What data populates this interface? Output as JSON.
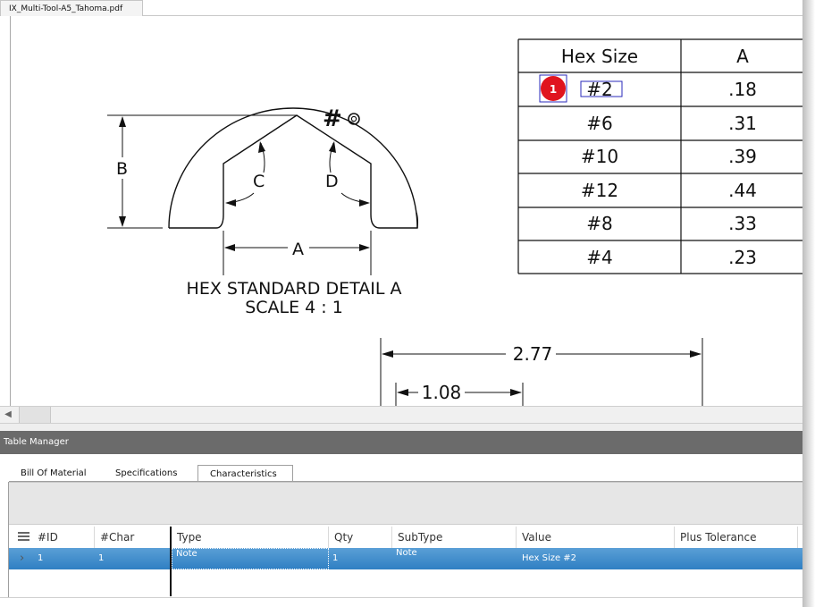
{
  "document": {
    "tab_title": "IX_Multi-Tool-A5_Tahoma.pdf"
  },
  "drawing": {
    "detail_title": "HEX STANDARD DETAIL A",
    "detail_scale": "SCALE 4 : 1",
    "hex_symbol": "#",
    "dim_a": "A",
    "dim_b": "B",
    "dim_c": "C",
    "dim_d": "D",
    "dim_277": "2.77",
    "dim_108": "1.08",
    "balloon_number": "1"
  },
  "hex_table": {
    "headers": [
      "Hex Size",
      "A"
    ],
    "rows": [
      [
        "#2",
        ".18"
      ],
      [
        "#6",
        ".31"
      ],
      [
        "#10",
        ".39"
      ],
      [
        "#12",
        ".44"
      ],
      [
        "#8",
        ".33"
      ],
      [
        "#4",
        ".23"
      ]
    ]
  },
  "table_manager": {
    "title": "Table Manager",
    "tabs": [
      "Bill Of Material",
      "Specifications",
      "Characteristics"
    ],
    "active_tab": "Characteristics",
    "columns": [
      "#ID",
      "#Char",
      "Type",
      "Qty",
      "SubType",
      "Value",
      "Plus Tolerance"
    ],
    "rows": [
      {
        "id": "1",
        "char": "1",
        "type": "Note",
        "qty": "1",
        "subtype": "Note",
        "value": "Hex Size #2",
        "plus_tolerance": ""
      }
    ]
  },
  "colors": {
    "balloon_red": "#e0141e",
    "selection_blue": "#2f7fc3",
    "header_gray": "#6b6b6b"
  }
}
